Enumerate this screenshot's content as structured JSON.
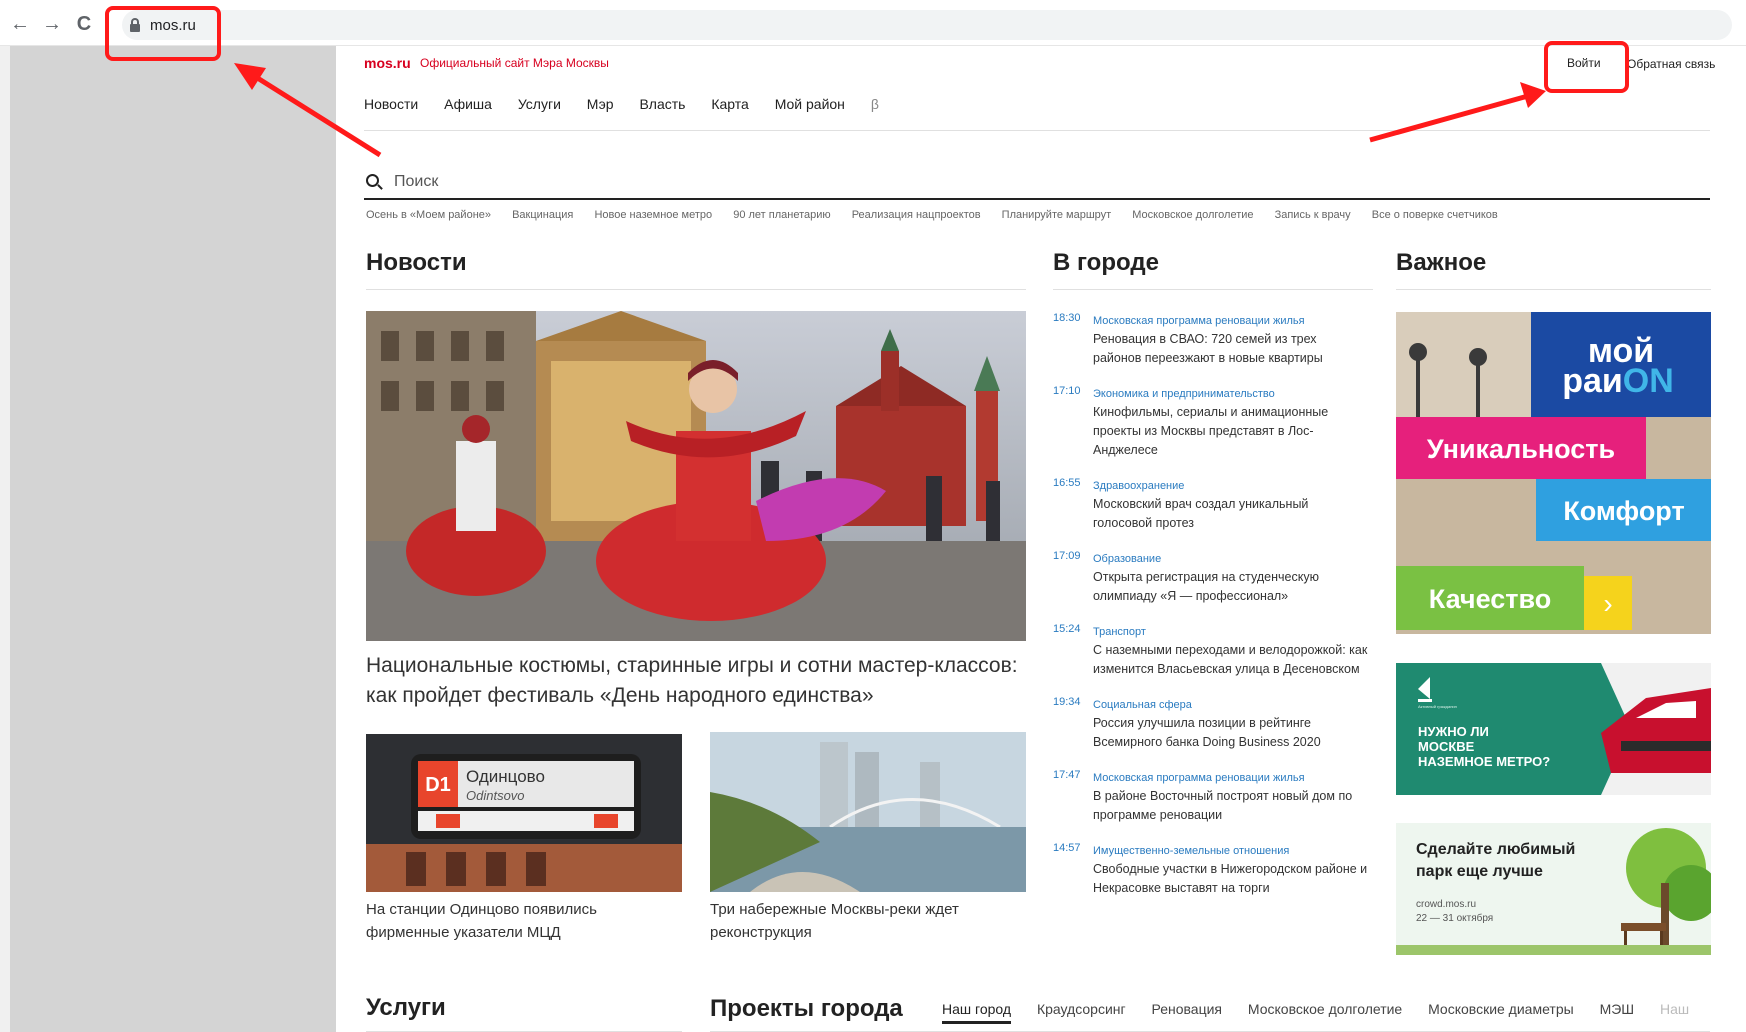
{
  "browser": {
    "back_icon": "←",
    "forward_icon": "→",
    "reload_icon": "C",
    "url": "mos.ru"
  },
  "header": {
    "logo": "mos.ru",
    "subtitle": "Официальный сайт Мэра Москвы",
    "login": "Войти",
    "feedback": "Обратная связь"
  },
  "nav": {
    "items": [
      "Новости",
      "Афиша",
      "Услуги",
      "Мэр",
      "Власть",
      "Карта",
      "Мой район"
    ],
    "beta": "β"
  },
  "search": {
    "placeholder": "Поиск"
  },
  "quick_links": [
    "Осень в «Моем районе»",
    "Вакцинация",
    "Новое наземное метро",
    "90 лет планетарию",
    "Реализация нацпроектов",
    "Планируйте маршрут",
    "Московское долголетие",
    "Запись к врачу",
    "Все о поверке счетчиков"
  ],
  "sections": {
    "news": "Новости",
    "city": "В городе",
    "important": "Важное",
    "services": "Услуги",
    "projects": "Проекты города"
  },
  "news": {
    "main_headline": "Национальные костюмы, старинные игры и сотни мастер-классов: как пройдет фестиваль «День народного единства»",
    "thumb1_caption": "На станции Одинцово появились фирменные указатели МЦД",
    "thumb2_caption": "Три набережные Москвы-реки ждет реконструкция",
    "sign_code": "D1",
    "sign_title": "Одинцово",
    "sign_subtitle": "Odintsovo"
  },
  "city_news": [
    {
      "time": "18:30",
      "category": "Московская программа реновации жилья",
      "text": "Реновация в СВАО: 720 семей из трех районов переезжают в новые квартиры"
    },
    {
      "time": "17:10",
      "category": "Экономика и предпринимательство",
      "text": "Кинофильмы, сериалы и анимационные проекты из Москвы представят в Лос-Анджелесе"
    },
    {
      "time": "16:55",
      "category": "Здравоохранение",
      "text": "Московский врач создал уникальный голосовой протез"
    },
    {
      "time": "17:09",
      "category": "Образование",
      "text": "Открыта регистрация на студенческую олимпиаду «Я — профессионал»"
    },
    {
      "time": "15:24",
      "category": "Транспорт",
      "text": "С наземными переходами и велодорожкой: как изменится Власьевская улица в Десеновском"
    },
    {
      "time": "19:34",
      "category": "Социальная сфера",
      "text": "Россия улучшила позиции в рейтинге Всемирного банка Doing Business 2020"
    },
    {
      "time": "17:47",
      "category": "Московская программа реновации жилья",
      "text": "В районе Восточный построят новый дом по программе реновации"
    },
    {
      "time": "14:57",
      "category": "Имущественно-земельные отношения",
      "text": "Свободные участки в Нижегородском районе и Некрасовке выставят на торги"
    }
  ],
  "important": {
    "banner1": {
      "logo_line1": "мой",
      "logo_line2a": "раи",
      "logo_line2b": "ON",
      "label1": "Уникальность",
      "label2": "Комфорт",
      "label3": "Качество",
      "arrow": "›"
    },
    "banner2": {
      "text": "НУЖНО ЛИ МОСКВЕ НАЗЕМНОЕ МЕТРО?",
      "logo_caption": "Активный гражданин"
    },
    "banner3": {
      "title": "Сделайте любимый парк еще лучше",
      "site": "crowd.mos.ru",
      "dates": "22 — 31 октября"
    }
  },
  "projects_tabs": [
    "Наш город",
    "Краудсорсинг",
    "Реновация",
    "Московское долголетие",
    "Московские диаметры",
    "МЭШ",
    "Наш"
  ],
  "colors": {
    "brand_red": "#d7001f",
    "link_blue": "#2a7bc0",
    "annotation_red": "#ff1a1a"
  }
}
